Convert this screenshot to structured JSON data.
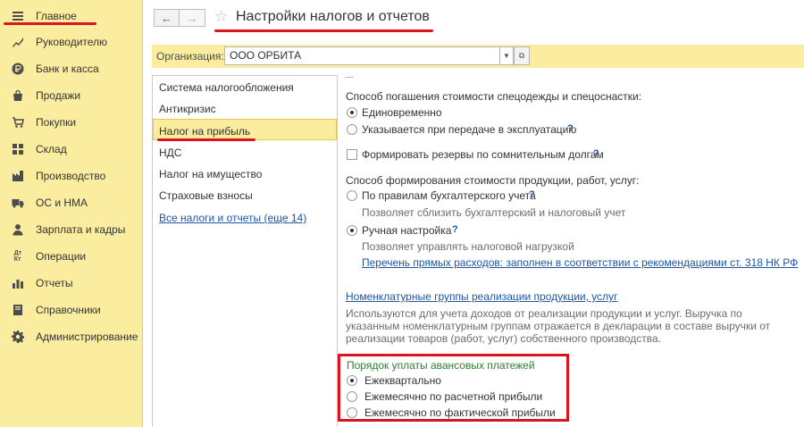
{
  "sidebar": {
    "items": [
      {
        "label": "Главное",
        "icon": "menu-icon"
      },
      {
        "label": "Руководителю",
        "icon": "chart-line-icon"
      },
      {
        "label": "Банк и касса",
        "icon": "ruble-coin-icon"
      },
      {
        "label": "Продажи",
        "icon": "shopping-bag-icon"
      },
      {
        "label": "Покупки",
        "icon": "cart-icon"
      },
      {
        "label": "Склад",
        "icon": "warehouse-grid-icon"
      },
      {
        "label": "Производство",
        "icon": "factory-icon"
      },
      {
        "label": "ОС и НМА",
        "icon": "truck-icon"
      },
      {
        "label": "Зарплата и кадры",
        "icon": "person-icon"
      },
      {
        "label": "Операции",
        "icon": "debit-credit-icon"
      },
      {
        "label": "Отчеты",
        "icon": "bar-chart-icon"
      },
      {
        "label": "Справочники",
        "icon": "book-icon"
      },
      {
        "label": "Администрирование",
        "icon": "gear-icon"
      }
    ]
  },
  "header": {
    "back": "←",
    "forward": "→",
    "title": "Настройки налогов и отчетов"
  },
  "org": {
    "label": "Организация:",
    "value": "ООО ОРБИТА"
  },
  "nav": {
    "items": [
      "Система налогообложения",
      "Антикризис",
      "Налог на прибыль",
      "НДС",
      "Налог на имущество",
      "Страховые взносы"
    ],
    "all_link": "Все налоги и отчеты (еще 14)"
  },
  "content": {
    "workwear_heading": "Способ погашения стоимости спецодежды и спецоснастки:",
    "workwear_opt1": "Единовременно",
    "workwear_opt2": "Указывается при передаче в эксплуатацию",
    "reserves_label": "Формировать резервы по сомнительным долгам",
    "cost_heading": "Способ формирования стоимости продукции, работ, услуг:",
    "cost_opt1": "По правилам бухгалтерского учета",
    "cost_opt1_hint": "Позволяет сблизить бухгалтерский и налоговый учет",
    "cost_opt2": "Ручная настройка",
    "cost_opt2_hint": "Позволяет управлять налоговой нагрузкой",
    "direct_costs_link": "Перечень прямых расходов: заполнен в соответствии с рекомендациями ст. 318 НК РФ",
    "nomenclature_link": "Номенклатурные группы реализации продукции, услуг",
    "nomenclature_desc1": "Используются для учета доходов от реализации продукции и услуг. Выручка по",
    "nomenclature_desc2": "указанным номенклатурным группам отражается в декларации в составе выручки от",
    "nomenclature_desc3": "реализации товаров (работ, услуг) собственного производства.",
    "advance_heading": "Порядок уплаты авансовых платежей",
    "advance_opt1": "Ежеквартально",
    "advance_opt2": "Ежемесячно по расчетной прибыли",
    "advance_opt3": "Ежемесячно по фактической прибыли",
    "help_mark": "?"
  }
}
